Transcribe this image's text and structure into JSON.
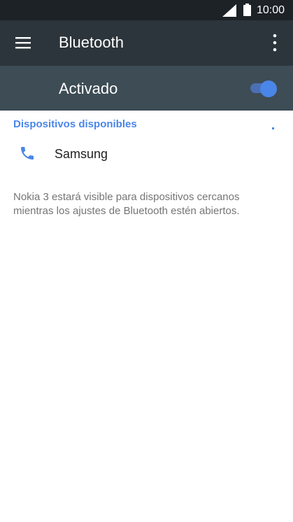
{
  "status_bar": {
    "time": "10:00",
    "icons": [
      "signal-icon",
      "battery-icon"
    ]
  },
  "app_bar": {
    "title": "Bluetooth",
    "icons": [
      "menu-icon",
      "more-vert-icon"
    ],
    "background": "#2c353b"
  },
  "bluetooth_toggle": {
    "label": "Activado",
    "state": "on",
    "background": "#3d4c55",
    "accent": "#4a86e8"
  },
  "available_devices": {
    "header": "Dispositivos disponibles",
    "devices": [
      {
        "name": "Samsung",
        "icon": "phone-icon"
      }
    ]
  },
  "footer_note": "Nokia 3 estará visible para dispositivos cercanos mientras los ajustes de Bluetooth estén abiertos."
}
